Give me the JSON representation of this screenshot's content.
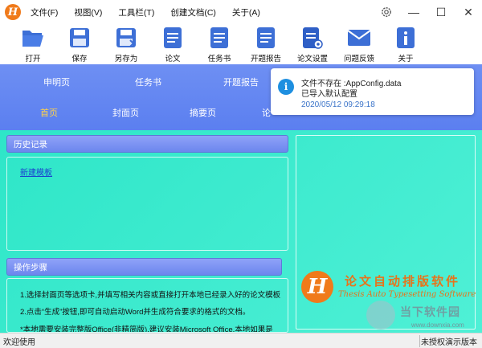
{
  "app": {
    "logo_letter": "H"
  },
  "menu": [
    "文件(F)",
    "视图(V)",
    "工具栏(T)",
    "创建文档(C)",
    "关于(A)"
  ],
  "window_controls": {
    "minimize": "—",
    "maximize": "☐",
    "close": "✕"
  },
  "toolbar": [
    {
      "label": "打开",
      "icon": "open-folder-icon"
    },
    {
      "label": "保存",
      "icon": "save-icon"
    },
    {
      "label": "另存为",
      "icon": "save-as-icon"
    },
    {
      "label": "论文",
      "icon": "thesis-doc-icon"
    },
    {
      "label": "任务书",
      "icon": "task-doc-icon"
    },
    {
      "label": "开题报告",
      "icon": "proposal-doc-icon"
    },
    {
      "label": "论文设置",
      "icon": "settings-doc-icon"
    },
    {
      "label": "问题反馈",
      "icon": "feedback-mail-icon"
    },
    {
      "label": "关于",
      "icon": "info-icon"
    }
  ],
  "tabs_row1": [
    "申明页",
    "任务书",
    "开题报告"
  ],
  "tabs_row2": [
    "首页",
    "封面页",
    "摘要页",
    "论"
  ],
  "active_tab": "首页",
  "notification": {
    "title": "文件不存在 :AppConfig.data",
    "subtitle": "已导入默认配置",
    "time": "2020/05/12 09:29:18"
  },
  "history": {
    "header": "历史记录",
    "link": "新建模板"
  },
  "steps": {
    "header": "操作步骤",
    "lines": [
      "1.选择封面页等选项卡,并填写相关内容或直接打开本地已经录入好的论文模板",
      "2.点击“生成”按钮,即可自动启动Word并生成符合要求的格式的文档。",
      "*本地需要安装完整版Office(非精简版),建议安装Microsoft Office,本地如果是"
    ]
  },
  "brand": {
    "logo_letter": "H",
    "title": "论文自动排版软件",
    "subtitle": "Thesis Auto Typesetting Software"
  },
  "watermark": {
    "text": "当下软件园",
    "url": "www.downxia.com"
  },
  "status": {
    "left": "欢迎使用",
    "right": "未授权演示版本"
  },
  "colors": {
    "accent": "#5b7ff0",
    "main_bg": "#2ee6c8",
    "active_tab": "#ffd24a",
    "brand": "#f07a1a"
  }
}
